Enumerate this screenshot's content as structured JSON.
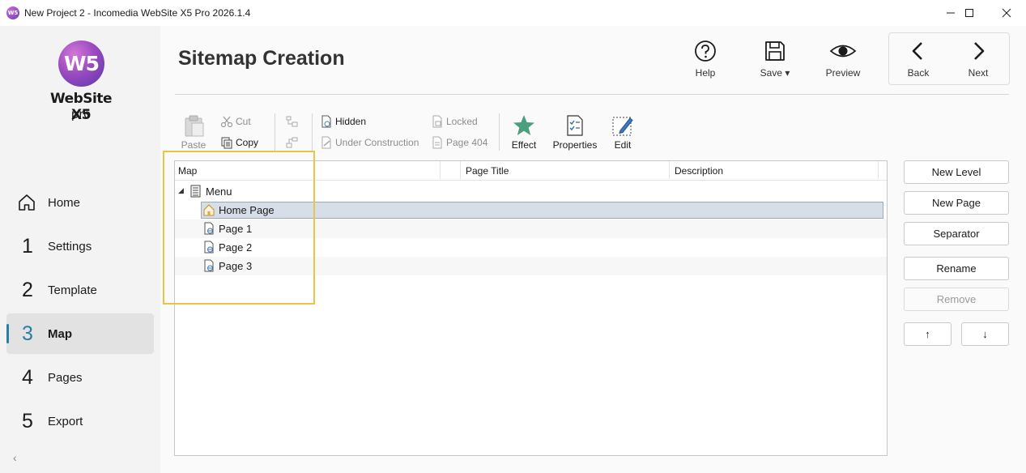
{
  "window": {
    "title": "New Project 2 - Incomedia WebSite X5 Pro 2026.1.4",
    "app_icon_text": "W5"
  },
  "logo": {
    "mark": "W5",
    "name": "WebSite X5",
    "edition": "pro"
  },
  "sidebar": {
    "items": [
      {
        "num": "",
        "icon": "home-icon",
        "label": "Home"
      },
      {
        "num": "1",
        "label": "Settings"
      },
      {
        "num": "2",
        "label": "Template"
      },
      {
        "num": "3",
        "label": "Map",
        "active": true
      },
      {
        "num": "4",
        "label": "Pages"
      },
      {
        "num": "5",
        "label": "Export"
      }
    ],
    "collapse_glyph": "‹",
    "accent_color": "#2a7ea1"
  },
  "header": {
    "title": "Sitemap Creation",
    "help_label": "Help",
    "save_label": "Save",
    "preview_label": "Preview",
    "back_label": "Back",
    "next_label": "Next"
  },
  "ribbon": {
    "paste": "Paste",
    "cut": "Cut",
    "copy": "Copy",
    "hidden": "Hidden",
    "under_construction": "Under Construction",
    "locked": "Locked",
    "page404": "Page 404",
    "effect": "Effect",
    "properties": "Properties",
    "edit": "Edit"
  },
  "grid": {
    "columns": [
      "Map",
      "Page Title",
      "Description"
    ],
    "root": {
      "label": "Menu",
      "expander": "◢"
    },
    "rows": [
      {
        "label": "Home Page",
        "icon": "home-page-icon",
        "selected": true
      },
      {
        "label": "Page 1",
        "icon": "page-icon"
      },
      {
        "label": "Page 2",
        "icon": "page-icon"
      },
      {
        "label": "Page 3",
        "icon": "page-icon"
      }
    ]
  },
  "actions": {
    "new_level": "New Level",
    "new_page": "New Page",
    "separator": "Separator",
    "rename": "Rename",
    "remove": "Remove",
    "move_up": "↑",
    "move_down": "↓"
  }
}
